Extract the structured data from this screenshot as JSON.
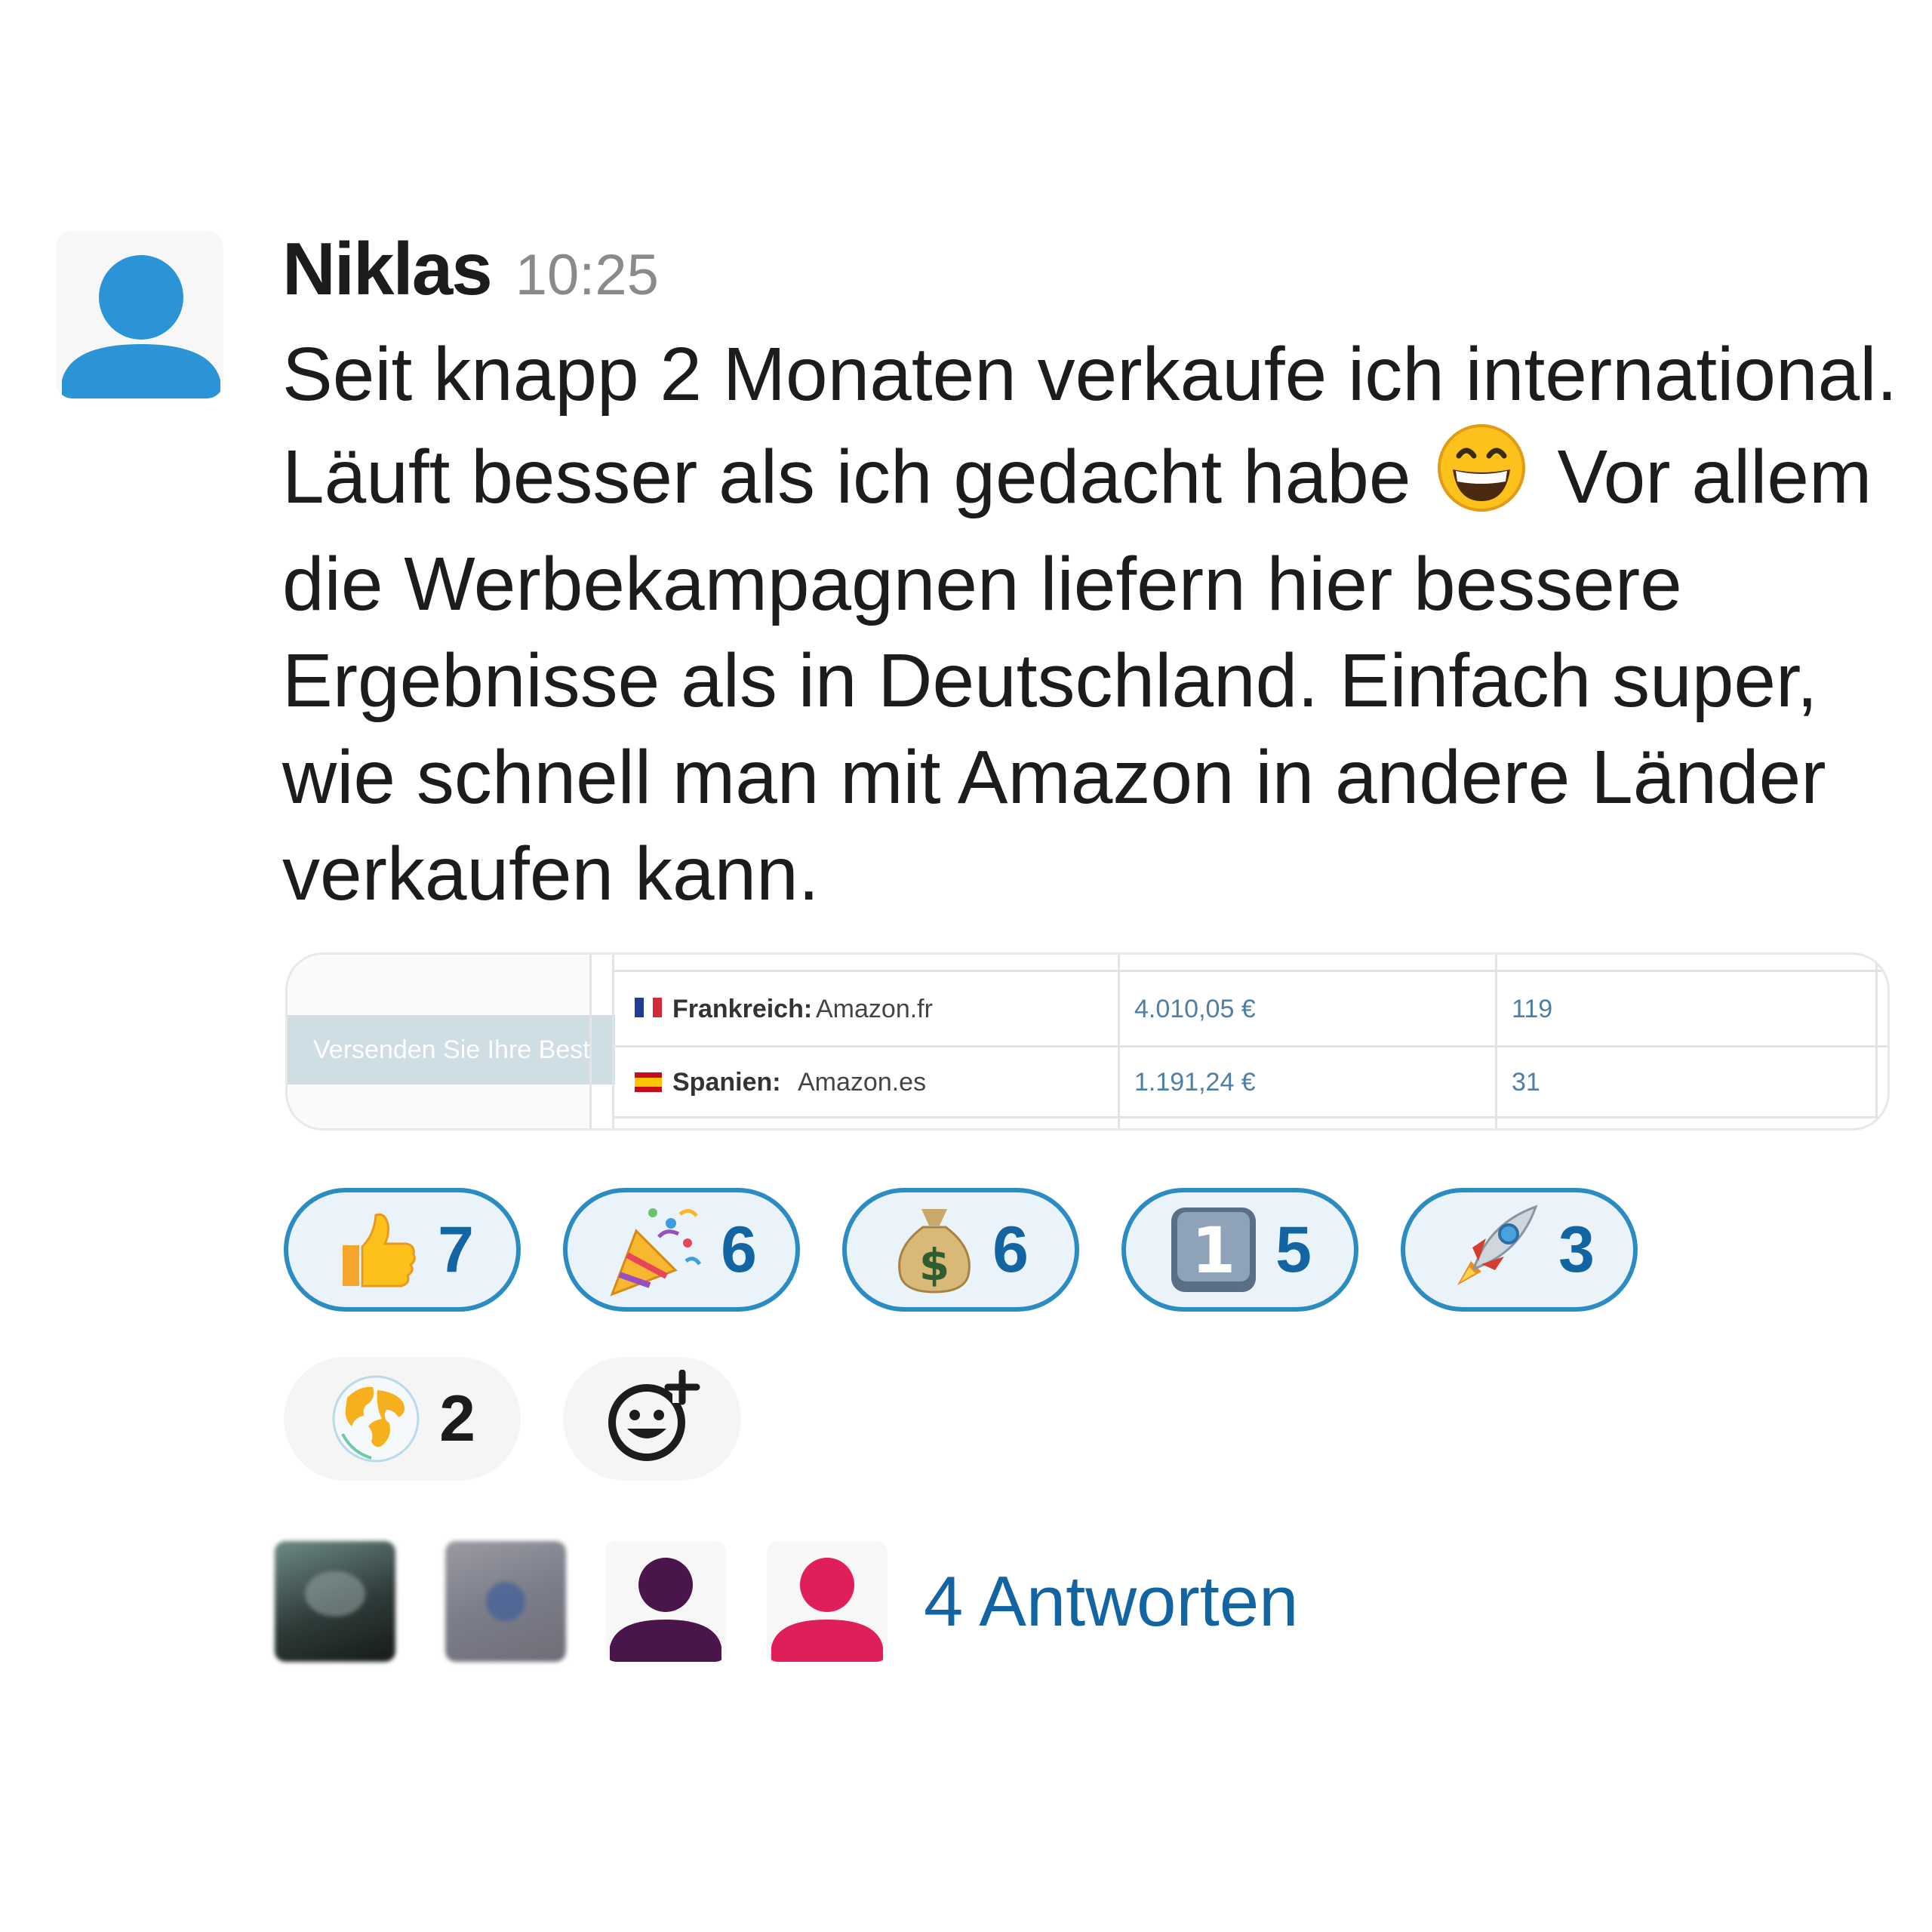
{
  "message": {
    "author": "Niklas",
    "time": "10:25",
    "text_1": "Seit knapp 2 Monaten verkaufe ich international. Läuft besser als ich gedacht habe",
    "text_2": "Vor allem die Werbekampagnen liefern hier bessere Ergebnisse als in Deutschland. Einfach super, wie schnell man mit Amazon in andere Länder verkaufen kann.",
    "inline_emoji": "grinning-face-icon"
  },
  "preview": {
    "banner_text": "Versenden Sie Ihre Best",
    "rows": [
      {
        "flag": "france-flag-icon",
        "country": "Frankreich:",
        "site": "Amazon.fr",
        "revenue": "4.010,05 €",
        "units": "119"
      },
      {
        "flag": "spain-flag-icon",
        "country": "Spanien:",
        "site": "Amazon.es",
        "revenue": "1.191,24 €",
        "units": "31"
      }
    ]
  },
  "reactions": [
    {
      "icon": "thumbs-up-icon",
      "count": "7",
      "active": true
    },
    {
      "icon": "party-popper-icon",
      "count": "6",
      "active": true
    },
    {
      "icon": "money-bag-icon",
      "count": "6",
      "active": true
    },
    {
      "icon": "keycap-one-icon",
      "count": "5",
      "active": true
    },
    {
      "icon": "rocket-icon",
      "count": "3",
      "active": true
    },
    {
      "icon": "globe-icon",
      "count": "2",
      "active": false
    }
  ],
  "add_reaction_icon": "add-reaction-icon",
  "thread": {
    "replies_label": "4 Antworten"
  },
  "colors": {
    "link": "#1264a3",
    "active_reaction_border": "#2b8bc3",
    "avatar_blue": "#2a94d6",
    "avatar_purple": "#4a154b",
    "avatar_pink": "#e01e5a"
  }
}
